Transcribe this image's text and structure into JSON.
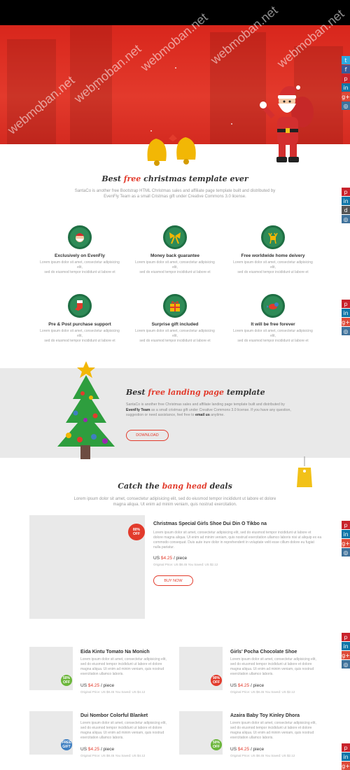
{
  "watermark": "webmoban.net",
  "hero": {},
  "section1": {
    "title_pre": "Best",
    "title_accent": "free",
    "title_post": "christmas template ever",
    "intro_line1": "SantaCo is another free Bootstrap HTML Christmas sales and affiliate page template built and distributed by",
    "intro_line2": "EvenFly Team as a small Cristmas gift under Creative Commons 3.0 license."
  },
  "features": [
    {
      "title": "Exclusively on EvenFly",
      "desc1": "Lorem ipsum dolor sit amet, consectetur adipisicing elit,",
      "desc2": "sed do eiusmod tempor incididunt ut labore et",
      "icon": "santa-face-icon"
    },
    {
      "title": "Money back guarantee",
      "desc1": "Lorem ipsum dolor sit amet, consectetur adipisicing elit,",
      "desc2": "sed do eiusmod tempor incididunt ut labore et",
      "icon": "ribbon-bow-icon"
    },
    {
      "title": "Free worldwide home deivery",
      "desc1": "Lorem ipsum dolor sit amet, consectetur adipisicing elit,",
      "desc2": "sed do eiusmod tempor incididunt ut labore et",
      "icon": "reindeer-icon"
    },
    {
      "title": "Pre & Post purchase support",
      "desc1": "Lorem ipsum dolor sit amet, consectetur adipisicing elit,",
      "desc2": "sed do eiusmod tempor incididunt ut labore et",
      "icon": "stocking-icon"
    },
    {
      "title": "Surprise gift included",
      "desc1": "Lorem ipsum dolor sit amet, consectetur adipisicing elit,",
      "desc2": "sed do eiusmod tempor incididunt ut labore et",
      "icon": "gift-box-icon"
    },
    {
      "title": "It will be free forever",
      "desc1": "Lorem ipsum dolor sit amet, consectetur adipisicing elit,",
      "desc2": "sed do eiusmod tempor incididunt ut labore et",
      "icon": "bird-icon"
    }
  ],
  "band": {
    "title_pre": "Best",
    "title_accent": "free landing page",
    "title_post": "template",
    "desc_line1": "SantaCo is another free Christmas sales and affiliate landing page template built and distributed by",
    "desc_evenfly": "EvenFly Team",
    "desc_line2": "as a small cristmas gift under Creative Commons 3.0 license. If you have any question,",
    "desc_line3": "suggestion or need assistance, feel free to",
    "desc_email": "email us",
    "desc_end": "anytime.",
    "download_label": "DOWNLOAD"
  },
  "deals": {
    "title_pre": "Catch the",
    "title_accent": "bang head",
    "title_post": "deals",
    "intro_line1": "Lorem ipsum dolor sit amet, consectetur adipisicing elit, sed do eiusmod tempor incididunt ut labore et dolore",
    "intro_line2": "magna aliqua. Ut enim ad minim veniam, quis nostrud exercitation.",
    "featured": {
      "name": "Christmas Special Girls Shoe Dui Din O Tikbo na",
      "off_pct": "80%",
      "off_word": "OFF",
      "desc1": "Lorem ipsum dolor sit amet, consectetur adipisicing elit, sed do eiusmod tempor incididunt ut labore et",
      "desc2": "dolore magna aliqua. Ut enim ad minim veniam, quis nostrud exercitation ullamco laboris nisi ut aliquip ex ea",
      "desc3": "commodo consequat. Duis aute irure dolor in reprehenderit in voluptate velit esse cillum dolore eu fugiat",
      "desc4": "nulla pariatur.",
      "currency": "US",
      "price": "$4.25",
      "unit": "/ piece",
      "original": "Original Price: US $8.45 You Saved: US $2.12",
      "buy_label": "BUY NOW"
    },
    "items": [
      {
        "name": "Eida Kintu Tomato Na Monich",
        "off_pct": "50%",
        "off_word": "OFF",
        "desc1": "Lorem ipsum dolor sit amet, consectetur adipisicing elit,",
        "desc2": "sed do eiusmod tempor incididunt ut labore et dolore",
        "desc3": "magna aliqua. Ut enim ad minim veniam, quis nostrud",
        "desc4": "exercitation ullamco laboris.",
        "currency": "US",
        "price": "$4.25",
        "unit": "/ piece",
        "original": "Original Price: US $8.45 You Saved: US $4.12"
      },
      {
        "name": "Girls' Pocha Chocolate Shoe",
        "off_pct": "90%",
        "off_word": "OFF",
        "desc1": "Lorem ipsum dolor sit amet, consectetur adipisicing elit,",
        "desc2": "sed do eiusmod tempor incididunt ut labore et dolore",
        "desc3": "magna aliqua. Ut enim ad minim veniam, quis nostrud",
        "desc4": "exercitation ullamco laboris.",
        "currency": "US",
        "price": "$4.25",
        "unit": "/ piece",
        "original": "Original Price: US $8.45 You Saved: US $2.12"
      },
      {
        "name": "Dui Nombor Colorful Blanket",
        "off_pct": "FREE",
        "off_word": "GIFT",
        "desc1": "Lorem ipsum dolor sit amet, consectetur adipisicing elit,",
        "desc2": "sed do eiusmod tempor incididunt ut labore et dolore",
        "desc3": "magna aliqua. Ut enim ad minim veniam, quis nostrud",
        "desc4": "exercitation ullamco laboris.",
        "currency": "US",
        "price": "$4.25",
        "unit": "/ piece",
        "original": "Original Price: US $8.45 You Saved: US $4.12"
      },
      {
        "name": "Azaira Baby Toy Kinley Dhora",
        "off_pct": "50%",
        "off_word": "OFF",
        "desc1": "Lorem ipsum dolor sit amet, consectetur adipisicing elit,",
        "desc2": "sed do eiusmod tempor incididunt ut labore et dolore",
        "desc3": "magna aliqua. Ut enim ad minim veniam, quis nostrud",
        "desc4": "exercitation ullamco laboris.",
        "currency": "US",
        "price": "$4.25",
        "unit": "/ piece",
        "original": "Original Price: US $8.45 You Saved: US $2.12"
      }
    ]
  },
  "social_glyphs": {
    "twitter": "t",
    "facebook": "f",
    "pinterest": "p",
    "linkedin": "in",
    "google": "g+",
    "instagram": "◎",
    "delicious": "d"
  }
}
